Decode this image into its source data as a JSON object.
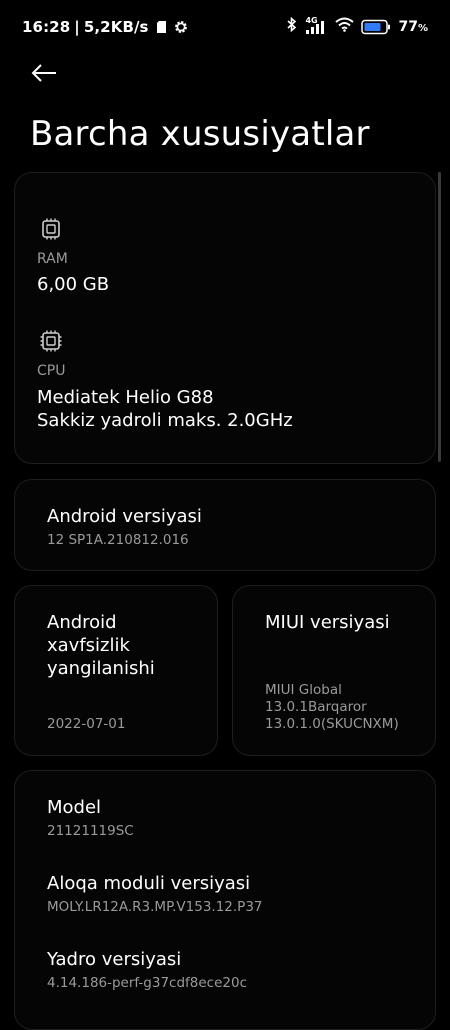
{
  "status_bar": {
    "time": "16:28",
    "separator": "|",
    "net_speed": "5,2KB/s",
    "network_type": "4G",
    "battery_percent": "77",
    "battery_suffix": "%",
    "icons": [
      "sd-card-icon",
      "settings-gear-icon",
      "bluetooth-icon",
      "signal-icon",
      "wifi-icon",
      "battery-icon"
    ]
  },
  "header": {
    "back_icon": "back-arrow-icon",
    "title": "Barcha xususiyatlar"
  },
  "hardware_card": {
    "ram": {
      "icon": "memory-chip-icon",
      "label": "RAM",
      "value": "6,00 GB"
    },
    "cpu": {
      "icon": "processor-chip-icon",
      "label": "CPU",
      "value_line1": "Mediatek Helio G88",
      "value_line2": "Sakkiz yadroli maks. 2.0GHz"
    }
  },
  "android_version": {
    "label": "Android versiyasi",
    "value": "12 SP1A.210812.016"
  },
  "security_update": {
    "label_line1": "Android",
    "label_line2": "xavfsizlik",
    "label_line3": "yangilanishi",
    "value": "2022-07-01"
  },
  "miui_version": {
    "label": "MIUI versiyasi",
    "value_line1": "MIUI Global",
    "value_line2": "13.0.1Barqaror",
    "value_line3": "13.0.1.0(SKUCNXM)"
  },
  "details": {
    "model": {
      "label": "Model",
      "value": "21121119SC"
    },
    "baseband": {
      "label": "Aloqa moduli versiyasi",
      "value": "MOLY.LR12A.R3.MP.V153.12.P37"
    },
    "kernel": {
      "label": "Yadro versiyasi",
      "value": "4.14.186-perf-g37cdf8ece20c"
    }
  },
  "colors": {
    "background": "#000000",
    "card_border": "#1e1e1e",
    "primary_text": "#ffffff",
    "secondary_text": "#9a9a9a"
  }
}
